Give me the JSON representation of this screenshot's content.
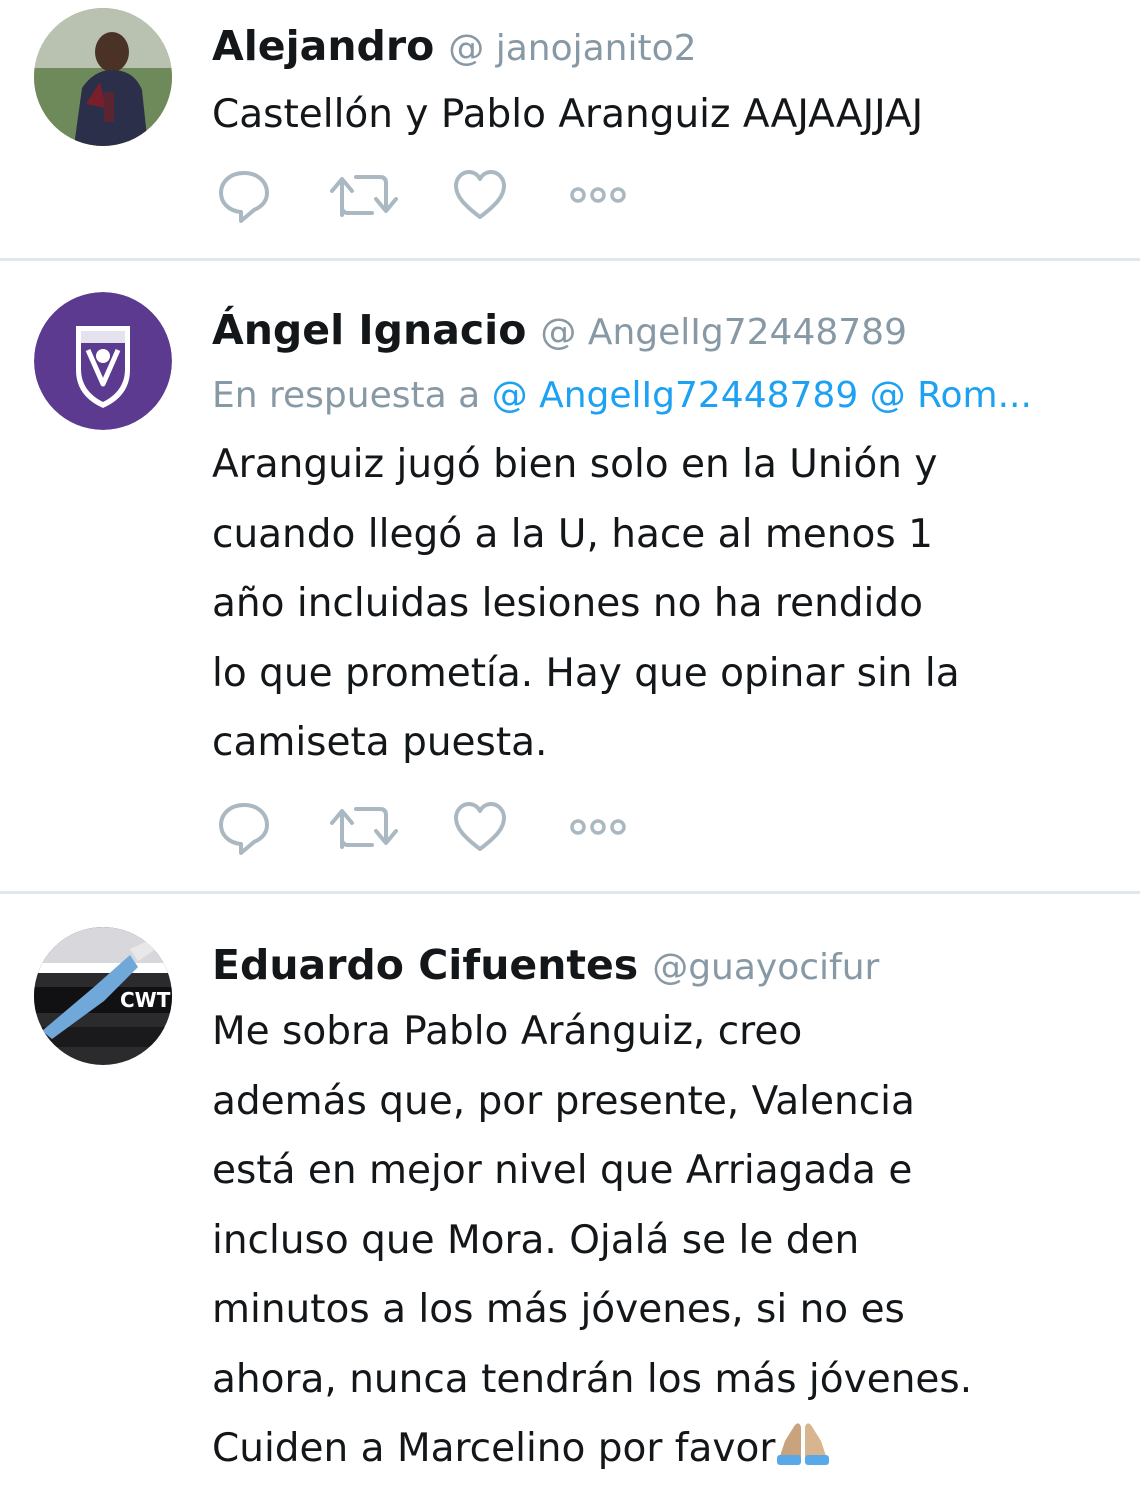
{
  "tweets": [
    {
      "name": "Alejandro",
      "handle": "@ janojanito2",
      "lines": [
        "Castellón y Pablo Aranguiz AAJAAJJAJ"
      ]
    },
    {
      "name": "Ángel Ignacio",
      "handle": "@ AngelIg72448789",
      "reply_prefix": "En respuesta a",
      "reply_to": "@ AngelIg72448789 @ Rom...",
      "lines": [
        "Aranguiz jugó bien solo en la Unión y",
        "cuando llegó a la U, hace al menos 1",
        "año incluidas lesiones no ha rendido",
        "lo que prometía. Hay que opinar sin la",
        "camiseta puesta."
      ]
    },
    {
      "name": "Eduardo Cifuentes",
      "handle": "@guayocifur",
      "lines": [
        "Me sobra Pablo Aránguiz, creo",
        "además que, por presente, Valencia",
        "está en mejor nivel que Arriagada e",
        "incluso que Mora. Ojalá se le den",
        "minutos a los más jóvenes, si no es",
        "ahora, nunca tendrán los más jóvenes.",
        "Cuiden a Marcelino por favor"
      ],
      "trailing_emoji": "folded-hands-emoji"
    }
  ],
  "icons": {
    "reply": "reply-icon",
    "retweet": "retweet-icon",
    "like": "heart-icon",
    "more": "more-dots-icon"
  },
  "colors": {
    "text": "#14171a",
    "muted": "#8899a6",
    "link": "#1da1f2",
    "divider": "#e1e8ed",
    "icon": "#aab8c2",
    "avatar_purple": "#5b3a8f"
  }
}
